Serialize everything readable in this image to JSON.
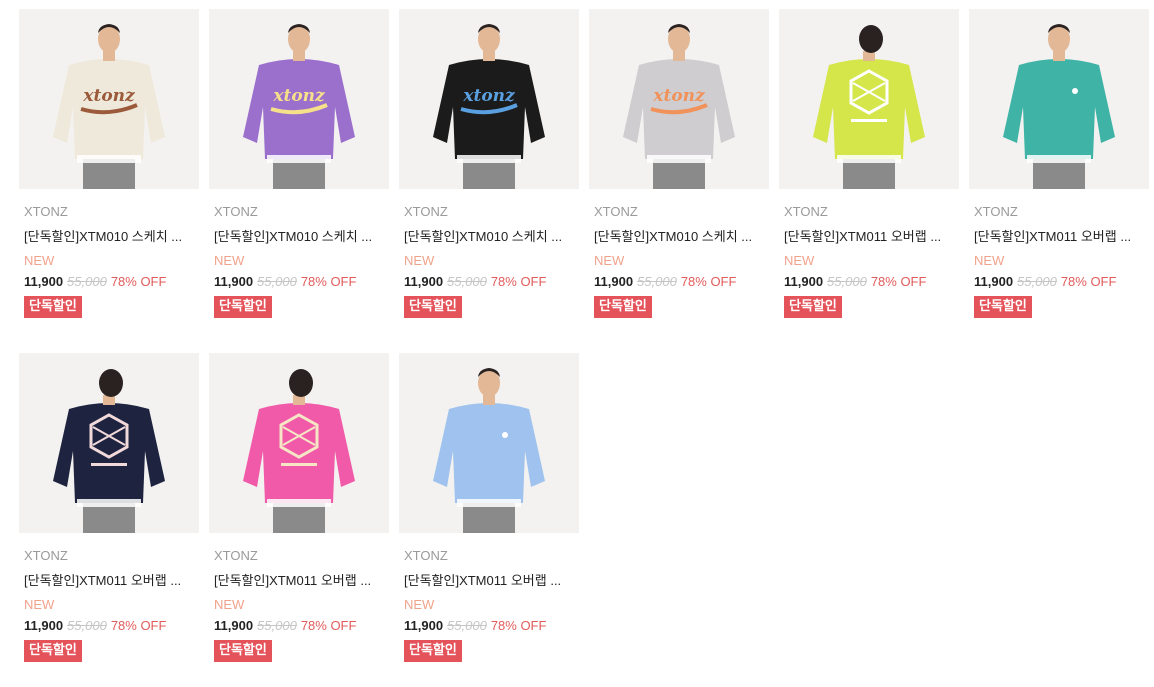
{
  "products": [
    {
      "brand": "XTONZ",
      "name": "[단독할인]XTM010 스케치 ...",
      "new": "NEW",
      "price": "11,900",
      "original_price": "55,000",
      "discount": "78% OFF",
      "badge": "단독할인",
      "color_name": "cream",
      "sweater_color": "#efe9dc",
      "print_color": "#9b5a3a",
      "print": "xtonz-script",
      "view": "front"
    },
    {
      "brand": "XTONZ",
      "name": "[단독할인]XTM010 스케치 ...",
      "new": "NEW",
      "price": "11,900",
      "original_price": "55,000",
      "discount": "78% OFF",
      "badge": "단독할인",
      "color_name": "purple",
      "sweater_color": "#9b6fcc",
      "print_color": "#f6e08a",
      "print": "xtonz-script",
      "view": "front"
    },
    {
      "brand": "XTONZ",
      "name": "[단독할인]XTM010 스케치 ...",
      "new": "NEW",
      "price": "11,900",
      "original_price": "55,000",
      "discount": "78% OFF",
      "badge": "단독할인",
      "color_name": "black",
      "sweater_color": "#1b1b1b",
      "print_color": "#5aa0e0",
      "print": "xtonz-script",
      "view": "front"
    },
    {
      "brand": "XTONZ",
      "name": "[단독할인]XTM010 스케치 ...",
      "new": "NEW",
      "price": "11,900",
      "original_price": "55,000",
      "discount": "78% OFF",
      "badge": "단독할인",
      "color_name": "grey",
      "sweater_color": "#cfcdd0",
      "print_color": "#f0925a",
      "print": "xtonz-script",
      "view": "front"
    },
    {
      "brand": "XTONZ",
      "name": "[단독할인]XTM011 오버랩 ...",
      "new": "NEW",
      "price": "11,900",
      "original_price": "55,000",
      "discount": "78% OFF",
      "badge": "단독할인",
      "color_name": "lime",
      "sweater_color": "#d4e64a",
      "print_color": "#ffffff",
      "print": "hex-logo",
      "view": "back"
    },
    {
      "brand": "XTONZ",
      "name": "[단독할인]XTM011 오버랩 ...",
      "new": "NEW",
      "price": "11,900",
      "original_price": "55,000",
      "discount": "78% OFF",
      "badge": "단독할인",
      "color_name": "teal",
      "sweater_color": "#3fb3a6",
      "print_color": "#ffffff",
      "print": "small-logo",
      "view": "front"
    },
    {
      "brand": "XTONZ",
      "name": "[단독할인]XTM011 오버랩 ...",
      "new": "NEW",
      "price": "11,900",
      "original_price": "55,000",
      "discount": "78% OFF",
      "badge": "단독할인",
      "color_name": "navy",
      "sweater_color": "#1e2440",
      "print_color": "#f3dada",
      "print": "hex-logo",
      "view": "back"
    },
    {
      "brand": "XTONZ",
      "name": "[단독할인]XTM011 오버랩 ...",
      "new": "NEW",
      "price": "11,900",
      "original_price": "55,000",
      "discount": "78% OFF",
      "badge": "단독할인",
      "color_name": "pink",
      "sweater_color": "#f05aa8",
      "print_color": "#f6e6c6",
      "print": "hex-logo",
      "view": "back"
    },
    {
      "brand": "XTONZ",
      "name": "[단독할인]XTM011 오버랩 ...",
      "new": "NEW",
      "price": "11,900",
      "original_price": "55,000",
      "discount": "78% OFF",
      "badge": "단독할인",
      "color_name": "sky-blue",
      "sweater_color": "#9fc3ee",
      "print_color": "#ffffff",
      "print": "small-logo",
      "view": "front"
    }
  ]
}
